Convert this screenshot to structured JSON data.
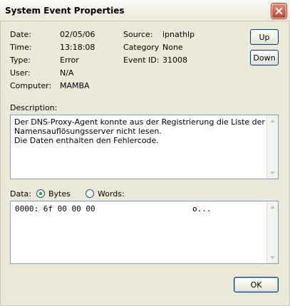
{
  "window": {
    "title": "System Event Properties"
  },
  "fields": {
    "date_label": "Date:",
    "date_value": "02/05/06",
    "time_label": "Time:",
    "time_value": "13:18:08",
    "type_label": "Type:",
    "type_value": "Error",
    "user_label": "User:",
    "user_value": "N/A",
    "computer_label": "Computer:",
    "computer_value": "MAMBA",
    "source_label": "Source:",
    "source_value": "ipnathlp",
    "category_label": "Category",
    "category_value": "None",
    "eventid_label": "Event ID:",
    "eventid_value": "31008"
  },
  "nav": {
    "up_label": "Up",
    "down_label": "Down"
  },
  "description": {
    "label": "Description:",
    "line1": "Der DNS-Proxy-Agent konnte aus der Registrierung die Liste der",
    "line2": "Namensauflösungsserver nicht lesen.",
    "line3": "Die Daten enthalten den Fehlercode."
  },
  "data": {
    "label": "Data:",
    "bytes_label": "Bytes",
    "words_label": "Words:",
    "selected": "Bytes",
    "hex_line": "0000: 6f 00 00 00",
    "ascii": "o..."
  },
  "ok_label": "OK",
  "colors": {
    "border": "#7f9db9",
    "radio_dot": "#21a121",
    "close": "#c2412c"
  }
}
